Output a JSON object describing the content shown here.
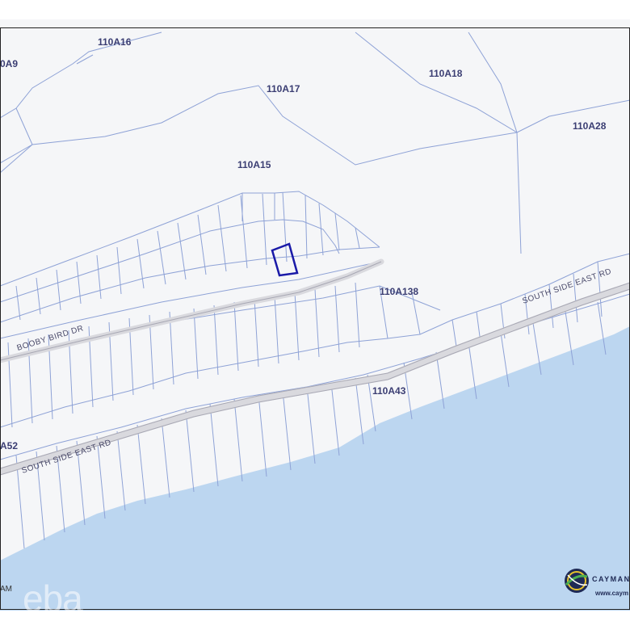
{
  "map": {
    "colors": {
      "land": "#f5f6f8",
      "water": "#bcd6f0",
      "parcel_line": "#8ea2d6",
      "road": "#d9d9de",
      "highlight": "#1a1aa8",
      "frame": "#222222"
    },
    "parcel_labels": [
      "110A16",
      "0A9",
      "110A17",
      "110A18",
      "110A28",
      "110A15",
      "110A138",
      "110A43",
      "A52"
    ],
    "road_labels": [
      "BOOBY BIRD DR",
      "SOUTH SIDE EAST RD",
      "SOUTH SIDE EAST RD"
    ],
    "highlighted_parcel": "selected-parcel"
  },
  "watermark": "eba",
  "copyright_fragment": "AM",
  "logo": {
    "brand": "CAYMAN",
    "url": "www.caym",
    "icon": "globe-icon"
  }
}
